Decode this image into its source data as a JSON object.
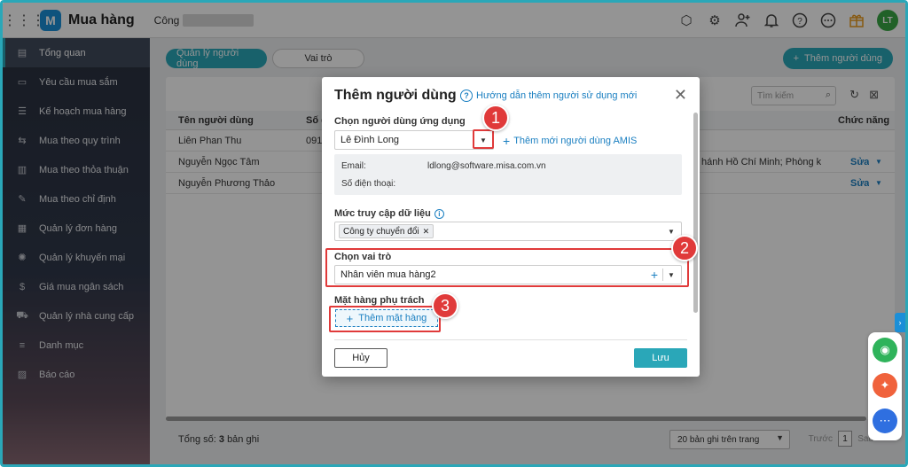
{
  "topbar": {
    "app_title": "Mua hàng",
    "company_prefix": "Công",
    "avatar_initials": "LT"
  },
  "sidebar": {
    "items": [
      {
        "label": "Tổng quan",
        "icon": "clipboard-icon",
        "active": true
      },
      {
        "label": "Yêu cầu mua sắm",
        "icon": "request-icon"
      },
      {
        "label": "Kế hoạch mua hàng",
        "icon": "plan-icon"
      },
      {
        "label": "Mua theo quy trình",
        "icon": "process-icon"
      },
      {
        "label": "Mua theo thỏa thuận",
        "icon": "agreement-icon"
      },
      {
        "label": "Mua theo chỉ định",
        "icon": "assign-icon"
      },
      {
        "label": "Quản lý đơn hàng",
        "icon": "order-icon"
      },
      {
        "label": "Quản lý khuyến mại",
        "icon": "promo-icon"
      },
      {
        "label": "Giá mua ngân sách",
        "icon": "budget-icon"
      },
      {
        "label": "Quản lý nhà cung cấp",
        "icon": "truck-icon"
      },
      {
        "label": "Danh mục",
        "icon": "catalog-icon"
      },
      {
        "label": "Báo cáo",
        "icon": "report-icon"
      }
    ]
  },
  "main": {
    "tabs": [
      "Quản lý người dùng",
      "Vai trò"
    ],
    "add_user_label": "Thêm người dùng",
    "search_placeholder": "Tìm kiếm",
    "table": {
      "col_name": "Tên người dùng",
      "col_second": "Số đ",
      "col_action": "Chức năng",
      "rows": [
        {
          "name": "Liên Phan Thu",
          "phone": "091",
          "branch": "",
          "action": ""
        },
        {
          "name": "Nguyễn Ngọc Tâm",
          "phone": "",
          "branch": "hánh Hồ Chí Minh; Phòng k",
          "action": "Sửa"
        },
        {
          "name": "Nguyễn Phương Thảo",
          "phone": "",
          "branch": "",
          "action": "Sửa"
        }
      ]
    },
    "footer": {
      "total_label": "Tổng số:",
      "total_value": "3",
      "total_unit": "bản ghi",
      "page_size": "20 bản ghi trên trang",
      "prev": "Trước",
      "page": "1",
      "next": "Sau"
    }
  },
  "modal": {
    "title": "Thêm người dùng",
    "help_link": "Hướng dẫn thêm người sử dụng mới",
    "select_user_label": "Chọn người dùng ứng dụng",
    "select_user_value": "Lê Đình Long",
    "add_amis_label": "Thêm mới người dùng AMIS",
    "email_key": "Email:",
    "email_value": "ldlong@software.misa.com.vn",
    "phone_key": "Số điện thoại:",
    "access_label": "Mức truy cập dữ liệu",
    "access_chip": "Công ty chuyển đổi",
    "role_label": "Chọn vai trò",
    "role_value": "Nhân viên mua hàng2",
    "items_label": "Mặt hàng phụ trách",
    "add_item_label": "Thêm mặt hàng",
    "cancel_label": "Hủy",
    "save_label": "Lưu"
  },
  "annotations": [
    "1",
    "2",
    "3"
  ],
  "colors": {
    "accent": "#2aa7b8",
    "link": "#1a7fc1",
    "annotation": "#e03a3a"
  }
}
